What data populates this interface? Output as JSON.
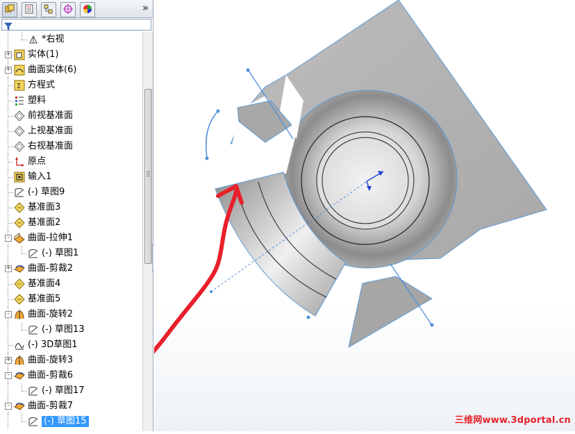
{
  "panel": {
    "tabs": [
      {
        "name": "feature-manager-icon"
      },
      {
        "name": "property-manager-icon"
      },
      {
        "name": "configuration-manager-icon"
      },
      {
        "name": "dimxpert-icon"
      },
      {
        "name": "display-manager-icon"
      }
    ],
    "more": "»",
    "filter_icon": "filter-icon"
  },
  "tree": [
    {
      "label": "*右视",
      "icon": "view-orientation-icon",
      "expand": null,
      "child": true
    },
    {
      "label": "实体(1)",
      "icon": "solid-bodies-icon",
      "expand": "+",
      "child": false
    },
    {
      "label": "曲面实体(6)",
      "icon": "surface-bodies-icon",
      "expand": "+",
      "child": false
    },
    {
      "label": "方程式",
      "icon": "equations-icon",
      "expand": null,
      "child": false
    },
    {
      "label": "塑料",
      "icon": "material-icon",
      "expand": null,
      "child": false
    },
    {
      "label": "前视基准面",
      "icon": "plane-icon",
      "expand": null,
      "child": false
    },
    {
      "label": "上视基准面",
      "icon": "plane-icon",
      "expand": null,
      "child": false
    },
    {
      "label": "右视基准面",
      "icon": "plane-icon",
      "expand": null,
      "child": false
    },
    {
      "label": "原点",
      "icon": "origin-icon",
      "expand": null,
      "child": false
    },
    {
      "label": "输入1",
      "icon": "imported-icon",
      "expand": null,
      "child": false
    },
    {
      "label": "(-) 草图9",
      "icon": "sketch-icon",
      "expand": null,
      "child": false
    },
    {
      "label": "基准面3",
      "icon": "ref-plane-icon",
      "expand": null,
      "child": false
    },
    {
      "label": "基准面2",
      "icon": "ref-plane-icon",
      "expand": null,
      "child": false
    },
    {
      "label": "曲面-拉伸1",
      "icon": "surface-extrude-icon",
      "expand": "-",
      "child": false
    },
    {
      "label": "(-) 草图1",
      "icon": "sketch-icon",
      "expand": null,
      "child": true
    },
    {
      "label": "曲面-剪裁2",
      "icon": "surface-trim-icon",
      "expand": "+",
      "child": false
    },
    {
      "label": "基准面4",
      "icon": "ref-plane-icon",
      "expand": null,
      "child": false
    },
    {
      "label": "基准面5",
      "icon": "ref-plane-icon",
      "expand": null,
      "child": false
    },
    {
      "label": "曲面-旋转2",
      "icon": "surface-revolve-icon",
      "expand": "-",
      "child": false
    },
    {
      "label": "(-) 草图13",
      "icon": "sketch-icon",
      "expand": null,
      "child": true
    },
    {
      "label": "(-) 3D草图1",
      "icon": "sketch-3d-icon",
      "expand": null,
      "child": false
    },
    {
      "label": "曲面-旋转3",
      "icon": "surface-revolve-icon",
      "expand": "+",
      "child": false
    },
    {
      "label": "曲面-剪裁6",
      "icon": "surface-trim-icon",
      "expand": "-",
      "child": false
    },
    {
      "label": "(-) 草图17",
      "icon": "sketch-icon",
      "expand": null,
      "child": true
    },
    {
      "label": "曲面-剪裁7",
      "icon": "surface-trim-icon",
      "expand": "-",
      "child": false
    },
    {
      "label": "(-) 草图15",
      "icon": "sketch-icon",
      "expand": null,
      "child": true,
      "selected": true
    }
  ],
  "viewport": {
    "watermark": "三维网www.3dportal.cn"
  },
  "colors": {
    "surface": "#b4b4b4",
    "edge": "#4a90d9",
    "annotation": "#e8202a",
    "selection": "#3399ff",
    "axis": "#1a3fd6"
  }
}
